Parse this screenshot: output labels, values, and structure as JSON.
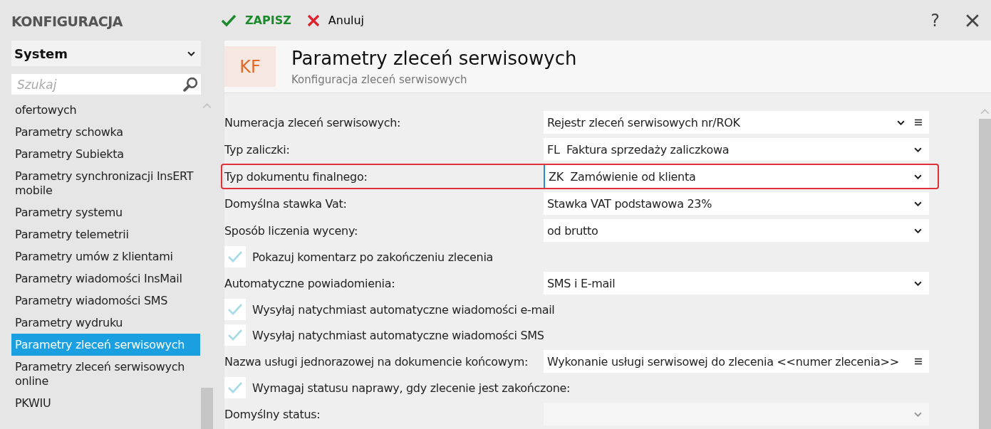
{
  "sidebar": {
    "title": "KONFIGURACJA",
    "category": "System",
    "search": {
      "placeholder": "Szukaj"
    },
    "items": [
      {
        "label": "ofertowych",
        "selected": false
      },
      {
        "label": "Parametry schowka",
        "selected": false
      },
      {
        "label": "Parametry Subiekta",
        "selected": false
      },
      {
        "label": "Parametry synchronizacji InsERT mobile",
        "selected": false
      },
      {
        "label": "Parametry systemu",
        "selected": false
      },
      {
        "label": "Parametry telemetrii",
        "selected": false
      },
      {
        "label": "Parametry umów z klientami",
        "selected": false
      },
      {
        "label": "Parametry wiadomości InsMail",
        "selected": false
      },
      {
        "label": "Parametry wiadomości SMS",
        "selected": false
      },
      {
        "label": "Parametry wydruku",
        "selected": false
      },
      {
        "label": "Parametry zleceń serwisowych",
        "selected": true
      },
      {
        "label": "Parametry zleceń serwisowych online",
        "selected": false
      },
      {
        "label": "PKWIU",
        "selected": false
      }
    ]
  },
  "toolbar": {
    "save": "ZAPISZ",
    "cancel": "Anuluj",
    "help": "?"
  },
  "header": {
    "badge": "KF",
    "title": "Parametry zleceń serwisowych",
    "subtitle": "Konfiguracja zleceń serwisowych"
  },
  "fields": [
    {
      "kind": "select",
      "label": "Numeracja zleceń serwisowych:",
      "value": "Rejestr zleceń serwisowych nr/ROK",
      "menu": true,
      "disabled": false,
      "highlighted": false
    },
    {
      "kind": "select",
      "label": "Typ zaliczki:",
      "value": "FL  Faktura sprzedaży zaliczkowa",
      "menu": false,
      "disabled": false,
      "highlighted": false
    },
    {
      "kind": "select",
      "label": "Typ dokumentu finalnego:",
      "value": "ZK  Zamówienie od klienta",
      "menu": false,
      "disabled": false,
      "highlighted": true
    },
    {
      "kind": "select",
      "label": "Domyślna stawka Vat:",
      "value": "Stawka VAT podstawowa 23%",
      "menu": false,
      "disabled": false,
      "highlighted": false
    },
    {
      "kind": "select",
      "label": "Sposób liczenia wyceny:",
      "value": "od brutto",
      "menu": false,
      "disabled": false,
      "highlighted": false
    },
    {
      "kind": "checkbox",
      "label": "Pokazuj komentarz po zakończeniu zlecenia",
      "checked": true
    },
    {
      "kind": "select",
      "label": "Automatyczne powiadomienia:",
      "value": "SMS i E-mail",
      "menu": false,
      "disabled": false,
      "highlighted": false
    },
    {
      "kind": "checkbox",
      "label": "Wysyłaj natychmiast automatyczne wiadomości e-mail",
      "checked": true
    },
    {
      "kind": "checkbox",
      "label": "Wysyłaj natychmiast automatyczne wiadomości SMS",
      "checked": true
    },
    {
      "kind": "text",
      "label": "Nazwa usługi jednorazowej na dokumencie końcowym:",
      "value": "Wykonanie usługi serwisowej do zlecenia <<numer zlecenia>>",
      "menu": true,
      "highlighted": false
    },
    {
      "kind": "checkbox",
      "label": "Wymagaj statusu naprawy, gdy zlecenie jest zakończone:",
      "checked": true
    },
    {
      "kind": "select",
      "label": "Domyślny status:",
      "menu": false,
      "disabled": true,
      "highlighted": false
    }
  ]
}
